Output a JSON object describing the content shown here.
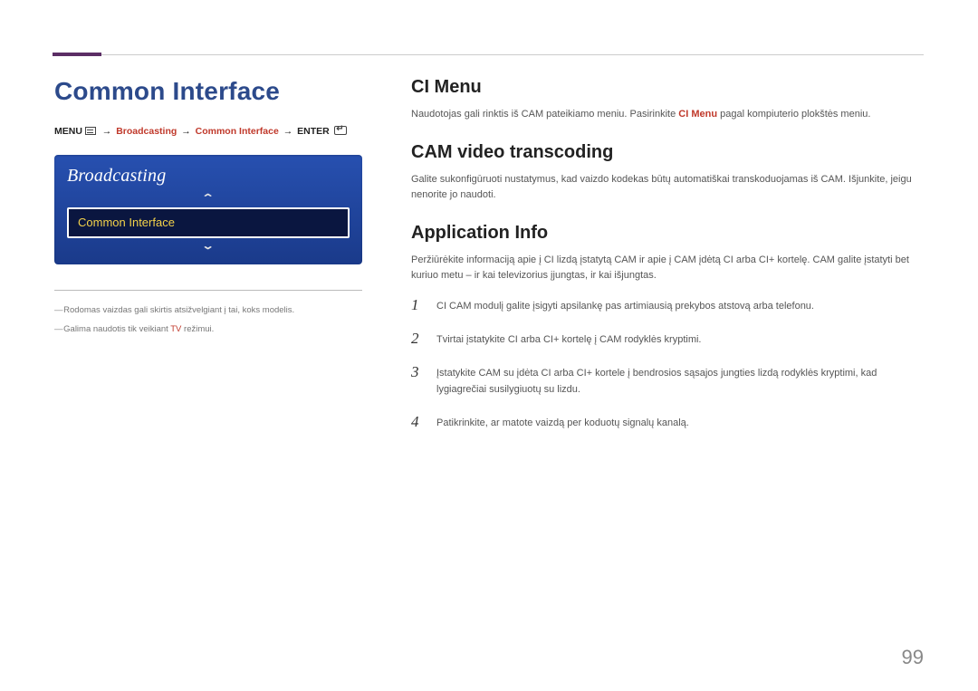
{
  "page_number": "99",
  "left": {
    "title": "Common Interface",
    "breadcrumb": {
      "menu_label": "MENU",
      "step1": "Broadcasting",
      "step2": "Common Interface",
      "enter_label": "ENTER"
    },
    "osd": {
      "panel_title": "Broadcasting",
      "selected_item": "Common Interface"
    },
    "notes": {
      "n1": "Rodomas vaizdas gali skirtis atsižvelgiant į tai, koks modelis.",
      "n2_pre": "Galima naudotis tik veikiant ",
      "n2_red": "TV",
      "n2_post": " režimui."
    }
  },
  "right": {
    "s1": {
      "heading": "CI Menu",
      "body_pre": "Naudotojas gali rinktis iš CAM pateikiamo meniu. Pasirinkite ",
      "body_red": "CI Menu",
      "body_post": " pagal kompiuterio plokštės meniu."
    },
    "s2": {
      "heading": "CAM video transcoding",
      "body": "Galite sukonfigūruoti nustatymus, kad vaizdo kodekas būtų automatiškai transkoduojamas iš CAM. Išjunkite, jeigu nenorite jo naudoti."
    },
    "s3": {
      "heading": "Application Info",
      "body": "Peržiūrėkite informaciją apie į CI lizdą įstatytą CAM ir apie į CAM įdėtą CI arba CI+ kortelę. CAM galite įstatyti bet kuriuo metu – ir kai televizorius įjungtas, ir kai išjungtas.",
      "steps": {
        "n1": "1",
        "t1": "CI CAM modulį galite įsigyti apsilankę pas artimiausią prekybos atstovą arba telefonu.",
        "n2": "2",
        "t2": "Tvirtai įstatykite CI arba CI+ kortelę į CAM rodyklės kryptimi.",
        "n3": "3",
        "t3": "Įstatykite CAM su įdėta CI arba CI+ kortele į bendrosios sąsajos jungties lizdą rodyklės kryptimi, kad lygiagrečiai susilygiuotų su lizdu.",
        "n4": "4",
        "t4": "Patikrinkite, ar matote vaizdą per koduotų signalų kanalą."
      }
    }
  }
}
